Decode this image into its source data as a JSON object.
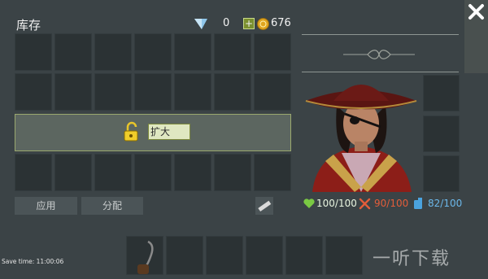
{
  "inventory": {
    "title": "库存",
    "gems": "0",
    "coins": "676",
    "expand_label": "扩大",
    "apply_label": "应用",
    "distribute_label": "分配",
    "colors": {
      "accent": "#9aa86e",
      "health": "#7ac943",
      "food": "#e35d3a",
      "water": "#4aa3df"
    }
  },
  "character": {
    "health": "100/100",
    "food": "90/100",
    "water": "82/100"
  },
  "hotbar": {
    "item_icon": "hook-icon"
  },
  "status": {
    "save_time": "Save time: 11:00:06"
  },
  "watermark": "一听下载"
}
